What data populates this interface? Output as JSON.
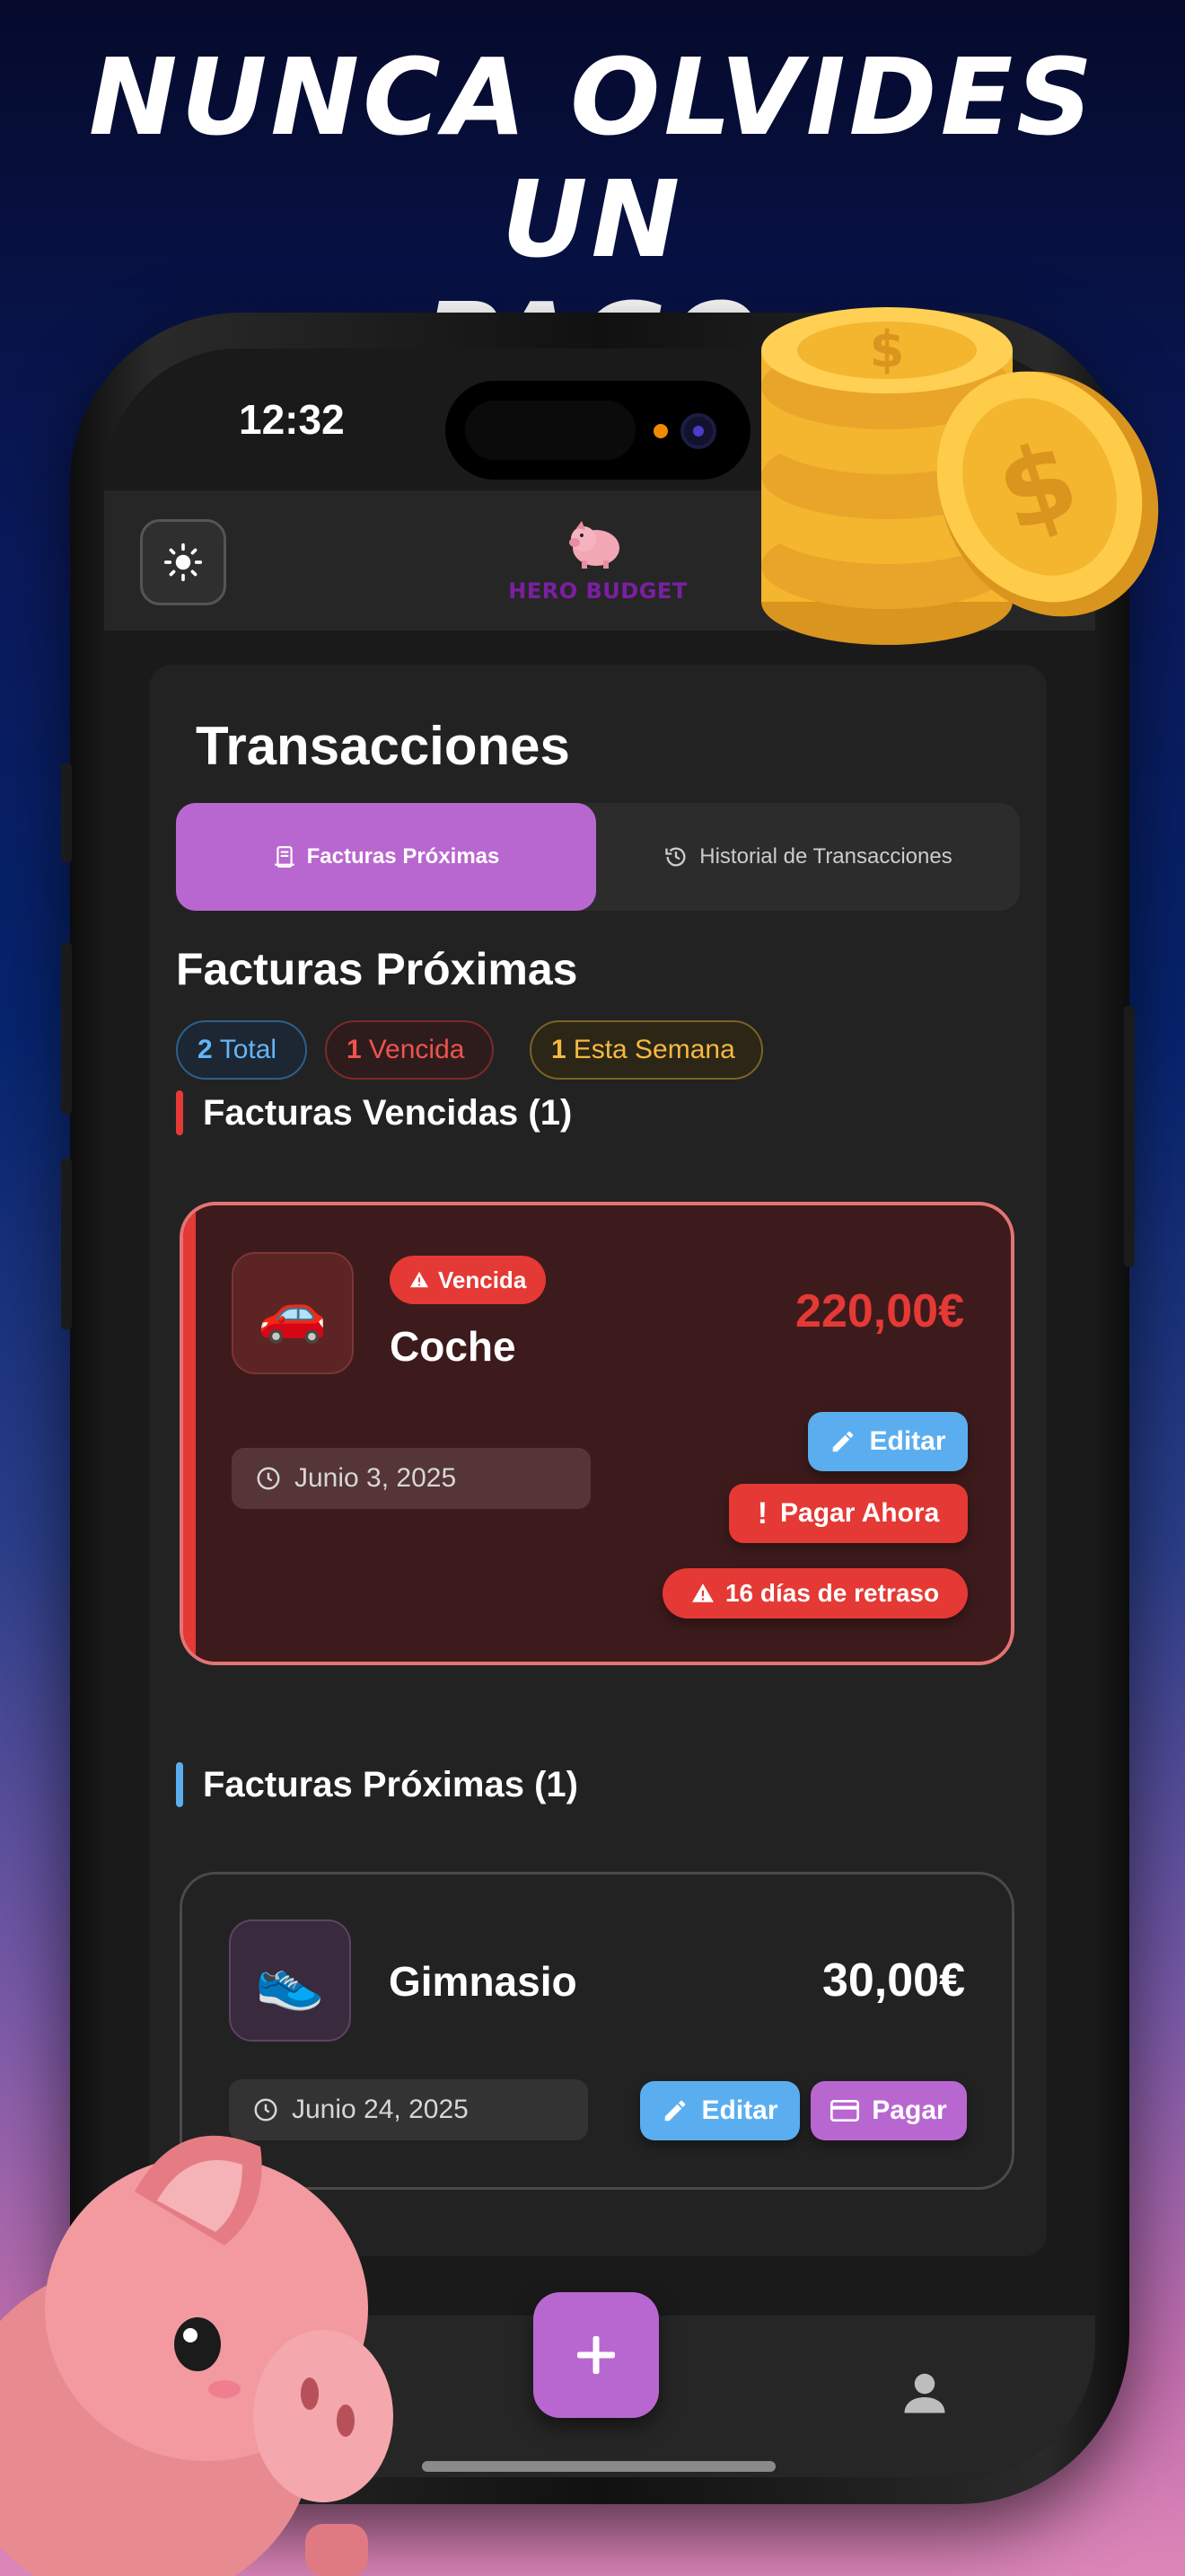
{
  "headline": {
    "line1": "NUNCA OLVIDES UN",
    "line2": "PAGO IMPORTANTE"
  },
  "status_bar": {
    "time": "12:32"
  },
  "app_bar": {
    "theme_icon": "sun-icon",
    "logo_text": "HERO BUDGET"
  },
  "page": {
    "title": "Transacciones",
    "tabs": [
      {
        "label": "Facturas Próximas",
        "icon": "receipt-icon",
        "active": true
      },
      {
        "label": "Historial de Transacciones",
        "icon": "history-icon",
        "active": false
      }
    ],
    "section_title": "Facturas Próximas",
    "chips": {
      "total": {
        "count": "2",
        "label": "Total"
      },
      "overdue": {
        "count": "1",
        "label": "Vencida"
      },
      "week": {
        "count": "1",
        "label": "Esta Semana"
      }
    }
  },
  "overdue_section": {
    "title": "Facturas Vencidas (1)",
    "bill": {
      "icon": "🚗",
      "badge": "Vencida",
      "name": "Coche",
      "amount": "220,00€",
      "date": "Junio 3, 2025",
      "edit_label": "Editar",
      "pay_label": "Pagar Ahora",
      "late_label": "16 días de retraso"
    }
  },
  "upcoming_section": {
    "title": "Facturas Próximas (1)",
    "bill": {
      "icon": "👟",
      "name": "Gimnasio",
      "amount": "30,00€",
      "date": "Junio 24, 2025",
      "edit_label": "Editar",
      "pay_label": "Pagar"
    }
  },
  "colors": {
    "accent_purple": "#b967d0",
    "danger_red": "#e53935",
    "info_blue": "#5aaef0",
    "warning_amber": "#f5b942"
  }
}
